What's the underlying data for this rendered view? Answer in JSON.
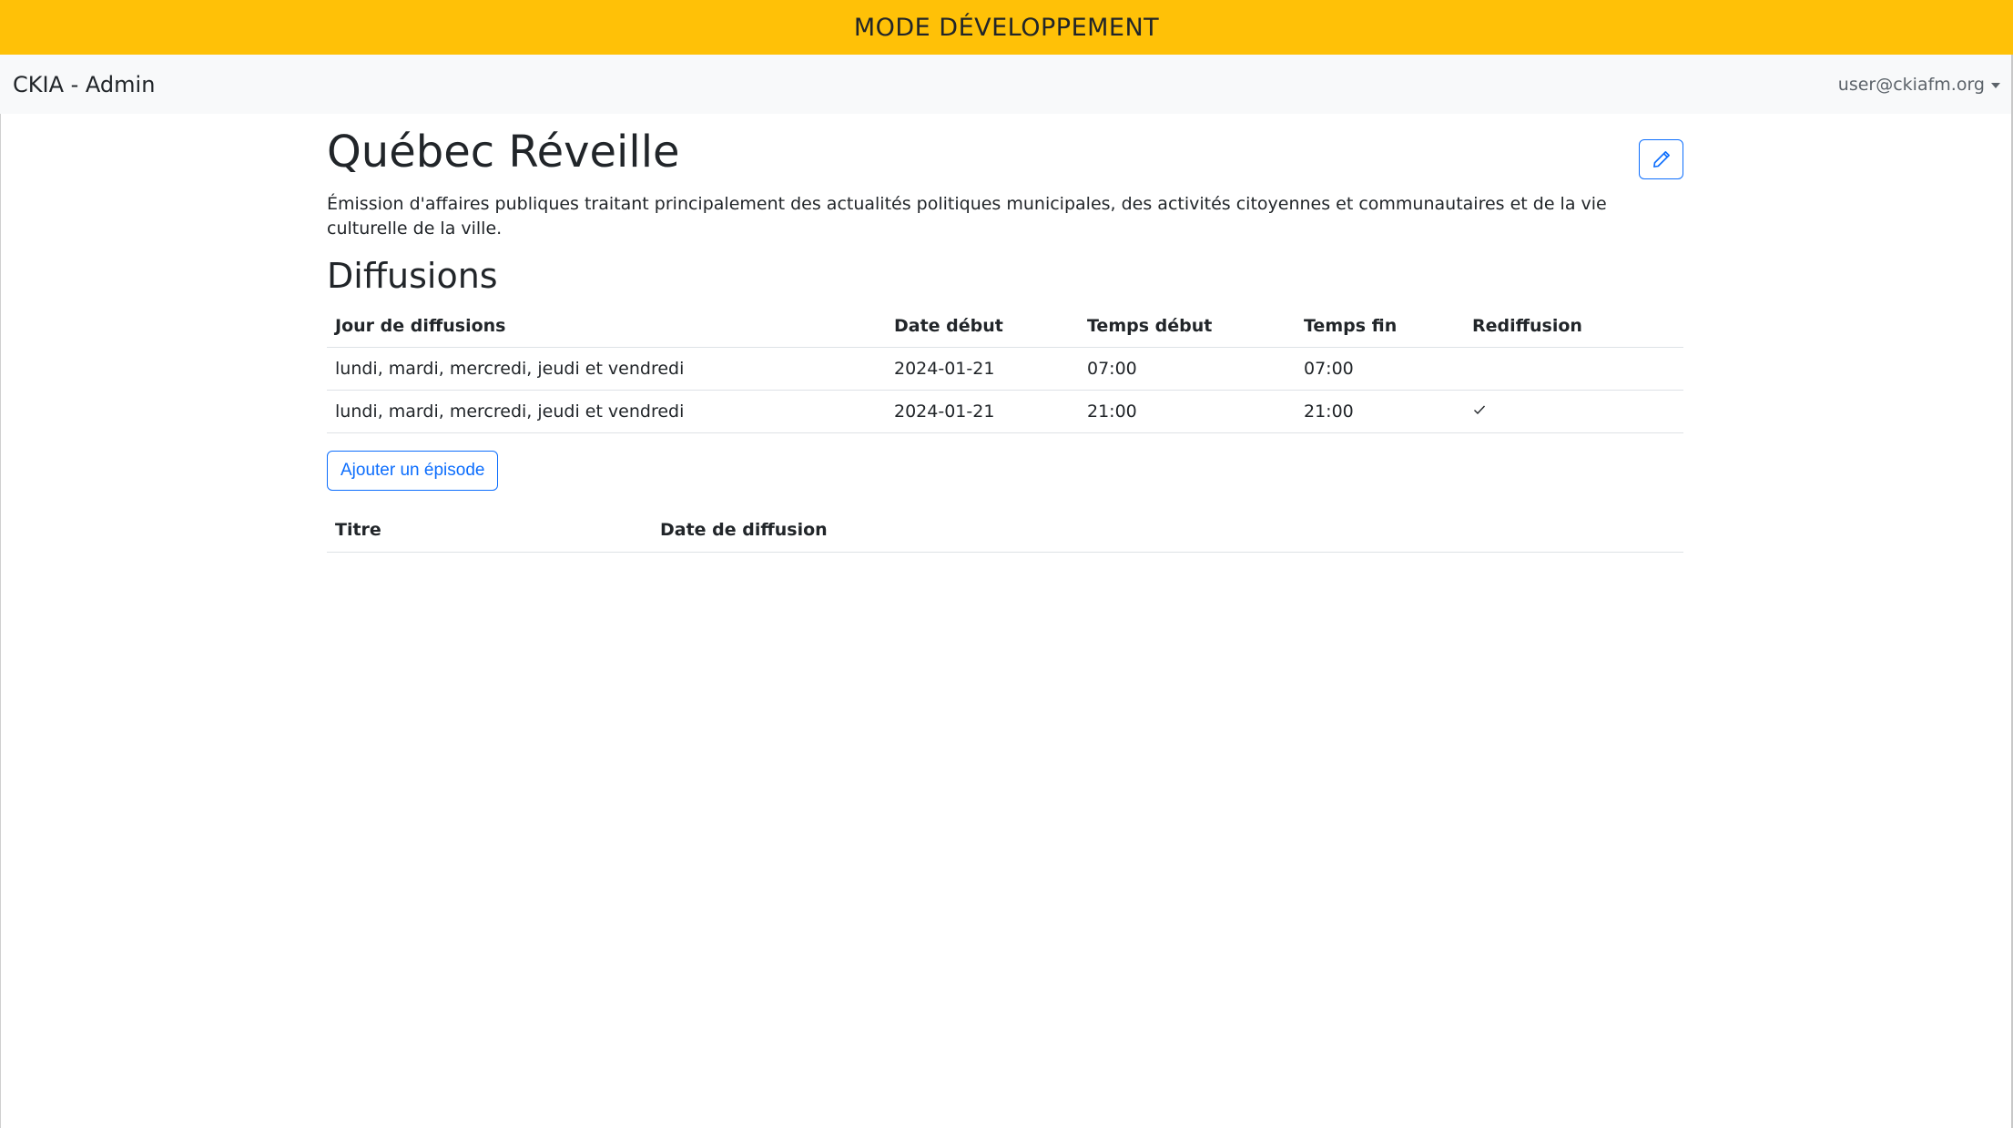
{
  "banner": {
    "text": "MODE DÉVELOPPEMENT"
  },
  "navbar": {
    "brand": "CKIA - Admin",
    "user": "user@ckiafm.org"
  },
  "show": {
    "title": "Québec Réveille",
    "description": "Émission d'affaires publiques traitant principalement des actualités politiques municipales, des activités citoyennes et communautaires et de la vie culturelle de la ville."
  },
  "diffusions": {
    "title": "Diffusions",
    "headers": [
      "Jour de diffusions",
      "Date début",
      "Temps début",
      "Temps fin",
      "Rediffusion"
    ],
    "rows": [
      {
        "days": "lundi, mardi, mercredi, jeudi et vendredi",
        "start_date": "2024-01-21",
        "start_time": "07:00",
        "end_time": "07:00",
        "rebroadcast": false
      },
      {
        "days": "lundi, mardi, mercredi, jeudi et vendredi",
        "start_date": "2024-01-21",
        "start_time": "21:00",
        "end_time": "21:00",
        "rebroadcast": true
      }
    ]
  },
  "episodes": {
    "add_label": "Ajouter un épisode",
    "headers": [
      "Titre",
      "Date de diffusion"
    ]
  },
  "icons": {
    "edit": "pencil-icon",
    "rebroadcast": "check-icon",
    "menu": "caret-down-icon"
  },
  "colors": {
    "banner": "#ffc107",
    "primary": "#0d6efd",
    "navbar": "#f8f9fa"
  }
}
